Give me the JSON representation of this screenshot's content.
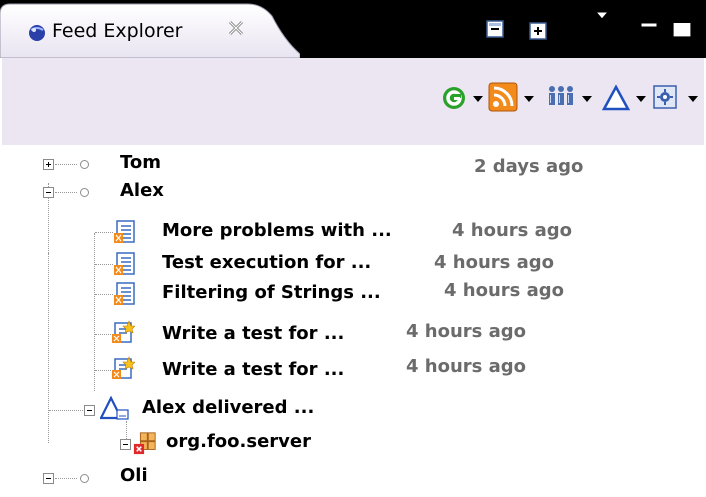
{
  "view": {
    "tab_title": "Feed Explorer",
    "tab_icon": "feed-globe-icon",
    "close_icon": "close-x-icon"
  },
  "title_actions": [
    {
      "name": "collapse-all-icon"
    },
    {
      "name": "expand-all-icon"
    },
    {
      "name": "view-menu-icon"
    },
    {
      "name": "minimize-icon"
    },
    {
      "name": "maximize-icon"
    }
  ],
  "toolbar": [
    {
      "name": "refresh-icon",
      "color": "#2aa12a"
    },
    {
      "name": "rss-feed-icon",
      "color": "#f28a1c"
    },
    {
      "name": "people-icon",
      "color": "#4a6fb0"
    },
    {
      "name": "build-icon",
      "color": "#2050c0"
    },
    {
      "name": "settings-icon",
      "color": "#3a5fb0"
    }
  ],
  "tree": {
    "rows": [
      {
        "label": "Tom",
        "time": "2 days ago",
        "expander": "plus",
        "icon": "user-dot-icon"
      },
      {
        "label": "Alex",
        "time": "",
        "expander": "minus",
        "icon": "user-dot-icon"
      },
      {
        "label": "More problems with ...",
        "time": "4 hours ago",
        "icon": "bug-report-icon"
      },
      {
        "label": "Test execution for ...",
        "time": "4 hours ago",
        "icon": "bug-report-icon"
      },
      {
        "label": "Filtering of Strings ...",
        "time": "4 hours ago",
        "icon": "bug-report-icon"
      },
      {
        "label": "Write a test for ...",
        "time": "4 hours ago",
        "icon": "task-new-icon"
      },
      {
        "label": "Write a test for ...",
        "time": "4 hours ago",
        "icon": "task-new-icon"
      },
      {
        "label": "Alex delivered ...",
        "time": "",
        "expander": "minus",
        "icon": "delivery-build-icon"
      },
      {
        "label": "org.foo.server",
        "time": "",
        "expander": "minus",
        "icon": "package-error-icon"
      },
      {
        "label": "Oli",
        "time": "",
        "expander": "minus",
        "icon": "user-dot-icon"
      }
    ]
  }
}
